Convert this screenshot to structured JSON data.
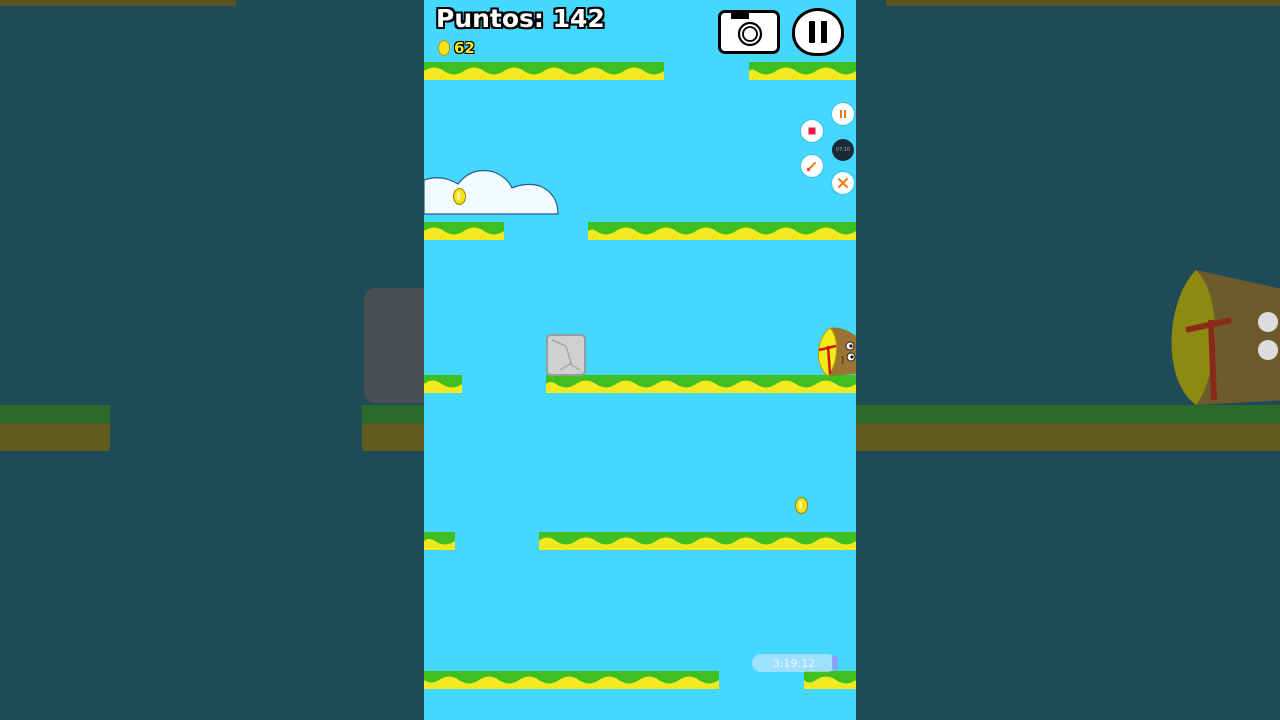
{
  "hud": {
    "score_label": "Puntos: 142",
    "coin_count": "62"
  },
  "controls": {
    "camera": "camera-icon",
    "pause": "pause-icon"
  },
  "recorder": {
    "timer": "07:10",
    "buttons": [
      "pause-icon",
      "stop-icon",
      "brush-icon",
      "close-icon"
    ]
  },
  "overlay": {
    "timestamp": "3:19:12"
  },
  "colors": {
    "sky": "#45d8ff",
    "grass": "#3fbf22",
    "sand": "#f2ea1f",
    "side_background": "#1f4b58"
  }
}
